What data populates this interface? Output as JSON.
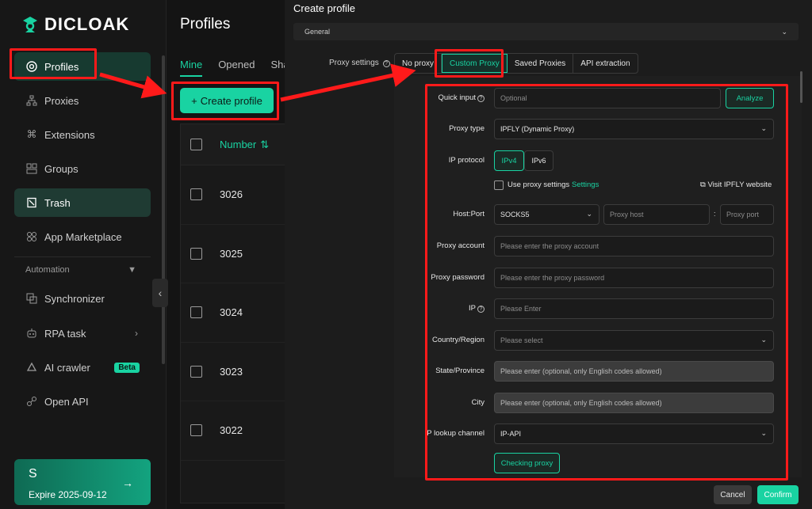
{
  "sidebar": {
    "brand": "DICLOAK",
    "items": [
      {
        "label": "Profiles",
        "icon": "chrome-icon"
      },
      {
        "label": "Proxies",
        "icon": "network-icon"
      },
      {
        "label": "Extensions",
        "icon": "command-icon"
      },
      {
        "label": "Groups",
        "icon": "grid-icon"
      },
      {
        "label": "Trash",
        "icon": "trash-icon"
      },
      {
        "label": "App Marketplace",
        "icon": "apps-icon"
      }
    ],
    "section_label": "Automation",
    "auto_items": [
      {
        "label": "Synchronizer",
        "icon": "sync-icon"
      },
      {
        "label": "RPA task",
        "icon": "robot-icon"
      },
      {
        "label": "AI crawler",
        "icon": "ai-icon",
        "badge": "Beta"
      },
      {
        "label": "Open API",
        "icon": "link-icon"
      }
    ],
    "expire": {
      "avatar": "S",
      "text": "Expire 2025-09-12",
      "arrow": "→"
    }
  },
  "main": {
    "title": "Profiles",
    "tabs": [
      "Mine",
      "Opened",
      "Share"
    ],
    "create_label": "Create profile",
    "column_number": "Number",
    "rows": [
      "3026",
      "3025",
      "3024",
      "3023",
      "3022"
    ]
  },
  "modal": {
    "title": "Create profile",
    "section": "General",
    "proxy_settings_label": "Proxy settings",
    "proxy_options": [
      "No proxy",
      "Custom Proxy",
      "Saved Proxies",
      "API extraction"
    ],
    "quick_input": {
      "label": "Quick input",
      "placeholder": "Optional",
      "button": "Analyze"
    },
    "proxy_type": {
      "label": "Proxy type",
      "value": "IPFLY (Dynamic Proxy)"
    },
    "ip_protocol": {
      "label": "IP protocol",
      "options": [
        "IPv4",
        "IPv6"
      ]
    },
    "use_proxy": {
      "label": "Use proxy settings",
      "link": "Settings",
      "visit": "Visit IPFLY website"
    },
    "host_port": {
      "label": "Host:Port",
      "protocol": "SOCKS5",
      "host_placeholder": "Proxy host",
      "sep": ":",
      "port_placeholder": "Proxy port"
    },
    "account": {
      "label": "Proxy account",
      "placeholder": "Please enter the proxy account"
    },
    "password": {
      "label": "Proxy password",
      "placeholder": "Please enter the proxy password"
    },
    "ip": {
      "label": "IP",
      "placeholder": "Please Enter"
    },
    "country": {
      "label": "Country/Region",
      "placeholder": "Please select"
    },
    "state": {
      "label": "State/Province",
      "placeholder": "Please enter (optional, only English codes allowed)"
    },
    "city": {
      "label": "City",
      "placeholder": "Please enter (optional, only English codes allowed)"
    },
    "lookup": {
      "label": "IP lookup channel",
      "value": "IP-API"
    },
    "checking_label": "Checking proxy",
    "cancel_label": "Cancel",
    "confirm_label": "Confirm"
  },
  "colors": {
    "accent": "#19d3a2",
    "annotation": "#ff1a1a",
    "background": "#141414"
  }
}
